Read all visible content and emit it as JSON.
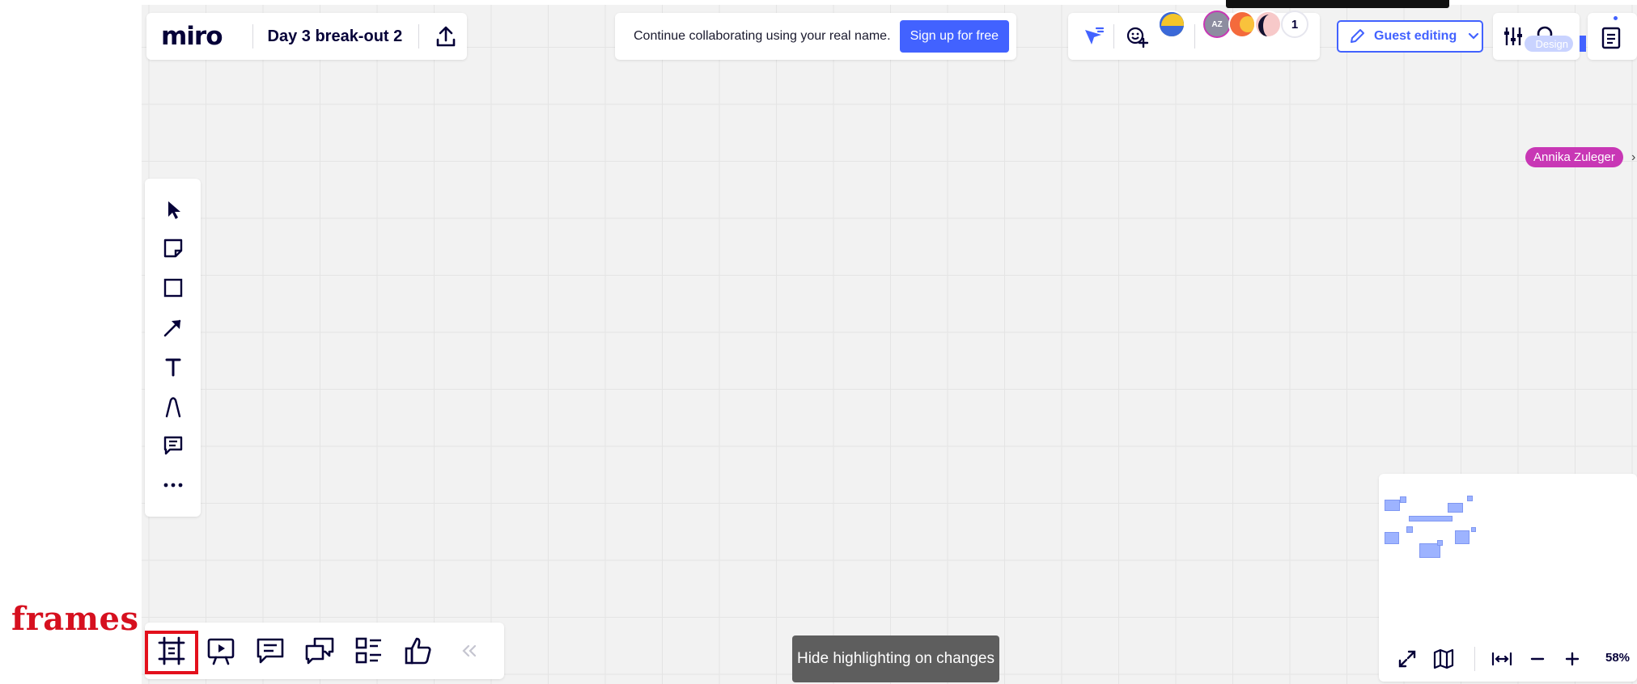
{
  "annotation": {
    "label": "frames"
  },
  "board": {
    "logo": "miro",
    "title": "Day 3 break-out 2"
  },
  "banner": {
    "text": "Continue collaborating using your real name.",
    "signup_label": "Sign up for free"
  },
  "collaborators": {
    "avatar_initials": "AZ",
    "extra_count": "1",
    "partial_label": "Design"
  },
  "guest": {
    "label": "Guest editing"
  },
  "presence": {
    "name": "Annika Zuleger"
  },
  "left_toolbar": {
    "items": [
      "select-tool",
      "sticky-note-tool",
      "shape-tool",
      "connection-line-tool",
      "text-tool",
      "pen-tool",
      "comment-tool",
      "more-tools"
    ]
  },
  "bottom_toolbar": {
    "items": [
      "frames",
      "presentation",
      "comments",
      "chat",
      "board-outline",
      "voting",
      "collapse"
    ]
  },
  "toast": {
    "text": "Hide highlighting on changes"
  },
  "zoom": {
    "level": "58%"
  },
  "colors": {
    "accent": "#4262ff",
    "annotation_red": "#d6101f",
    "presence_tag": "#c837b5",
    "toast_bg": "#5e5e5e",
    "canvas": "#f2f2f2"
  }
}
